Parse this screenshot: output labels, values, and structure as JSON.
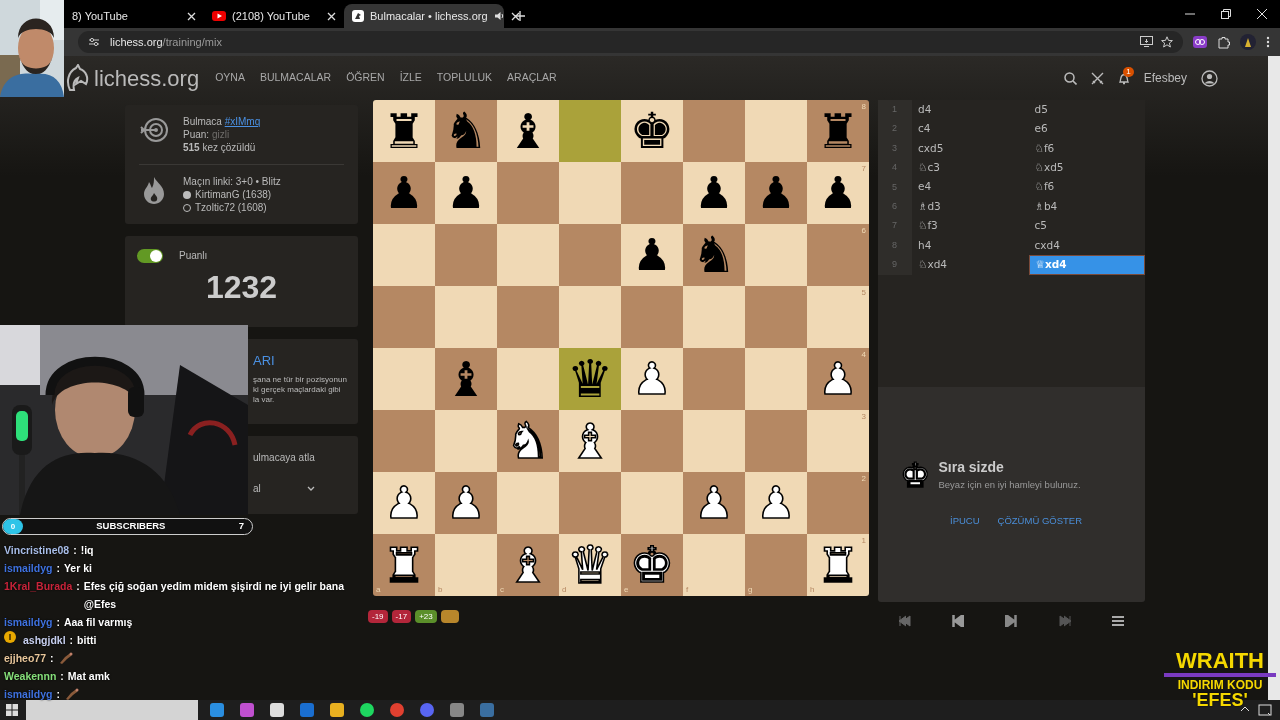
{
  "browser": {
    "tabs": [
      {
        "title": "8) YouTube",
        "selected": false
      },
      {
        "title": "(2108) YouTube",
        "kind": "youtube",
        "selected": false
      },
      {
        "title": "Bulmacalar • lichess.org",
        "kind": "lichess",
        "selected": true,
        "audio": true
      }
    ],
    "url_host": "lichess.org",
    "url_path": "/training/mix"
  },
  "site": {
    "logo": "lichess.org",
    "nav": [
      "OYNA",
      "BULMACALAR",
      "ÖĞREN",
      "İZLE",
      "TOPLULUK",
      "ARAÇLAR"
    ],
    "notifications": "1",
    "user": "Efesbey"
  },
  "puzzle": {
    "title": "Bulmaca",
    "id": "#xIMmq",
    "rating_label": "Puan:",
    "rating": "gizli",
    "solved": "**515** kez çözüldü",
    "game": "Maçın linki: 3+0 • Blitz",
    "players": [
      {
        "name": "KirtimanG (1638)",
        "kind": "white"
      },
      {
        "name": "Tzoltic72 (1608)",
        "kind": "black"
      }
    ]
  },
  "rated": {
    "label": "Puanlı",
    "on": true,
    "rating": "1232"
  },
  "theme_card": {
    "title": "ARI",
    "lines": [
      "şana ne tür bir pozisyonun",
      "ki gerçek maçlardaki gibi",
      "la var."
    ]
  },
  "next_card": {
    "label": "ulmacaya atla",
    "select": "al"
  },
  "board": {
    "files": [
      "a",
      "b",
      "c",
      "d",
      "e",
      "f",
      "g",
      "h"
    ],
    "ranks": [
      "8",
      "7",
      "6",
      "5",
      "4",
      "3",
      "2",
      "1"
    ],
    "squares": [
      [
        {
          "highlighted": false,
          "piece": "♜",
          "kind": "rook",
          "white": false
        },
        {
          "highlighted": false,
          "piece": "♞",
          "kind": "knight",
          "white": false
        },
        {
          "highlighted": false,
          "piece": "♝",
          "kind": "bishop",
          "white": false
        },
        {
          "highlighted": true
        },
        {
          "highlighted": false,
          "piece": "♚",
          "kind": "king",
          "white": false
        },
        {
          "highlighted": false
        },
        {
          "highlighted": false
        },
        {
          "highlighted": false,
          "piece": "♜",
          "kind": "rook",
          "white": false
        }
      ],
      [
        {
          "highlighted": false,
          "piece": "♟",
          "kind": "pawn",
          "white": false
        },
        {
          "highlighted": false,
          "piece": "♟",
          "kind": "pawn",
          "white": false
        },
        {
          "highlighted": false
        },
        {
          "highlighted": false
        },
        {
          "highlighted": false
        },
        {
          "highlighted": false,
          "piece": "♟",
          "kind": "pawn",
          "white": false
        },
        {
          "highlighted": false,
          "piece": "♟",
          "kind": "pawn",
          "white": false
        },
        {
          "highlighted": false,
          "piece": "♟",
          "kind": "pawn",
          "white": false
        }
      ],
      [
        {
          "highlighted": false
        },
        {
          "highlighted": false
        },
        {
          "highlighted": false
        },
        {
          "highlighted": false
        },
        {
          "highlighted": false,
          "piece": "♟",
          "kind": "pawn",
          "white": false
        },
        {
          "highlighted": false,
          "piece": "♞",
          "kind": "knight",
          "white": false
        },
        {
          "highlighted": false
        },
        {
          "highlighted": false
        }
      ],
      [
        {
          "highlighted": false
        },
        {
          "highlighted": false
        },
        {
          "highlighted": false
        },
        {
          "highlighted": false
        },
        {
          "highlighted": false
        },
        {
          "highlighted": false
        },
        {
          "highlighted": false
        },
        {
          "highlighted": false
        }
      ],
      [
        {
          "highlighted": false
        },
        {
          "highlighted": false,
          "piece": "♝",
          "kind": "bishop",
          "white": false
        },
        {
          "highlighted": false
        },
        {
          "highlighted": true,
          "piece": "♛",
          "kind": "queen",
          "white": false
        },
        {
          "highlighted": false,
          "piece": "♟",
          "kind": "pawn",
          "white": true
        },
        {
          "highlighted": false
        },
        {
          "highlighted": false
        },
        {
          "highlighted": false,
          "piece": "♟",
          "kind": "pawn",
          "white": true
        }
      ],
      [
        {
          "highlighted": false
        },
        {
          "highlighted": false
        },
        {
          "highlighted": false,
          "piece": "♞",
          "kind": "knight",
          "white": true
        },
        {
          "highlighted": false,
          "piece": "♝",
          "kind": "bishop",
          "white": true
        },
        {
          "highlighted": false
        },
        {
          "highlighted": false
        },
        {
          "highlighted": false
        },
        {
          "highlighted": false
        }
      ],
      [
        {
          "highlighted": false,
          "piece": "♟",
          "kind": "pawn",
          "white": true
        },
        {
          "highlighted": false,
          "piece": "♟",
          "kind": "pawn",
          "white": true
        },
        {
          "highlighted": false
        },
        {
          "highlighted": false
        },
        {
          "highlighted": false
        },
        {
          "highlighted": false,
          "piece": "♟",
          "kind": "pawn",
          "white": true
        },
        {
          "highlighted": false,
          "piece": "♟",
          "kind": "pawn",
          "white": true
        },
        {
          "highlighted": false
        }
      ],
      [
        {
          "highlighted": false,
          "piece": "♜",
          "kind": "rook",
          "white": true
        },
        {
          "highlighted": false
        },
        {
          "highlighted": false,
          "piece": "♝",
          "kind": "bishop",
          "white": true
        },
        {
          "highlighted": false,
          "piece": "♛",
          "kind": "queen",
          "white": true
        },
        {
          "highlighted": false,
          "piece": "♚",
          "kind": "king",
          "white": true
        },
        {
          "highlighted": false
        },
        {
          "highlighted": false
        },
        {
          "highlighted": false,
          "piece": "♜",
          "kind": "rook",
          "white": true
        }
      ]
    ]
  },
  "streak": [
    {
      "label": "-19",
      "color": "#b3263a"
    },
    {
      "label": "-17",
      "color": "#b3263a"
    },
    {
      "label": "+23",
      "color": "#5b8f2a"
    },
    {
      "color": "#b8862b"
    }
  ],
  "moves": [
    {
      "number": "1",
      "white": {
        "san": "d4",
        "selected": false
      },
      "black": {
        "san": "d5",
        "selected": false
      }
    },
    {
      "number": "2",
      "white": {
        "san": "c4",
        "selected": false
      },
      "black": {
        "san": "e6",
        "selected": false
      }
    },
    {
      "number": "3",
      "white": {
        "san": "cxd5",
        "selected": false
      },
      "black": {
        "san": "♘f6",
        "selected": false
      }
    },
    {
      "number": "4",
      "white": {
        "san": "♘c3",
        "selected": false
      },
      "black": {
        "san": "♘xd5",
        "selected": false
      }
    },
    {
      "number": "5",
      "white": {
        "san": "e4",
        "selected": false
      },
      "black": {
        "san": "♘f6",
        "selected": false
      }
    },
    {
      "number": "6",
      "white": {
        "san": "♗d3",
        "selected": false
      },
      "black": {
        "san": "♗b4",
        "selected": false
      }
    },
    {
      "number": "7",
      "white": {
        "san": "♘f3",
        "selected": false
      },
      "black": {
        "san": "c5",
        "selected": false
      }
    },
    {
      "number": "8",
      "white": {
        "san": "h4",
        "selected": false
      },
      "black": {
        "san": "cxd4",
        "selected": false
      }
    },
    {
      "number": "9",
      "white": {
        "san": "♘xd4",
        "selected": false
      },
      "black": {
        "san": "♕xd4",
        "selected": true
      }
    }
  ],
  "prompt": {
    "piece": "♚",
    "title": "Sıra sizde",
    "text": "Beyaz için en iyi hamleyi bulunuz.",
    "actions": [
      "İPUCU",
      "ÇÖZÜMÜ GÖSTER"
    ]
  },
  "controls": [
    {
      "kind": "first"
    },
    {
      "kind": "prev"
    },
    {
      "kind": "next"
    },
    {
      "kind": "last"
    },
    {
      "kind": "menu"
    }
  ],
  "overlay": {
    "subscribers": {
      "current": "0",
      "label": "SUBSCRIBERS",
      "goal": "7"
    },
    "chat": [
      {
        "user": "Vincristine08",
        "color": "#a8bde8",
        "sep": ":",
        "kind": "text",
        "text": "!iq"
      },
      {
        "user": "ismaildyg",
        "color": "#3f72e0",
        "sep": ":",
        "kind": "text",
        "text": "Yer ki"
      },
      {
        "user": "1Kral_Burada",
        "color": "#c8243a",
        "sep": ":",
        "kind": "text",
        "text": "Efes çiğ soğan yedim midem şişirdi ne iyi gelir bana @Efes"
      },
      {
        "user": "ismaildyg",
        "color": "#3f72e0",
        "sep": ":",
        "kind": "text",
        "text": "Aaa fil varmış"
      },
      {
        "user": "ashgjdkl",
        "color": "#c8d0f0",
        "sep": ":",
        "kind": "text",
        "badge": true,
        "text": "bitti"
      },
      {
        "user": "ejjheo77",
        "color": "#e8c69a",
        "sep": ":",
        "kind": "emote"
      },
      {
        "user": "Weakennn",
        "color": "#86e07a",
        "sep": ":",
        "kind": "text",
        "text": "Mat amk"
      },
      {
        "user": "ismaildyg",
        "color": "#3f72e0",
        "sep": ":",
        "kind": "emote"
      }
    ],
    "sponsor": {
      "brand": "WRAITH",
      "line": "INDIRIM KODU",
      "code": "'EFES'"
    }
  }
}
